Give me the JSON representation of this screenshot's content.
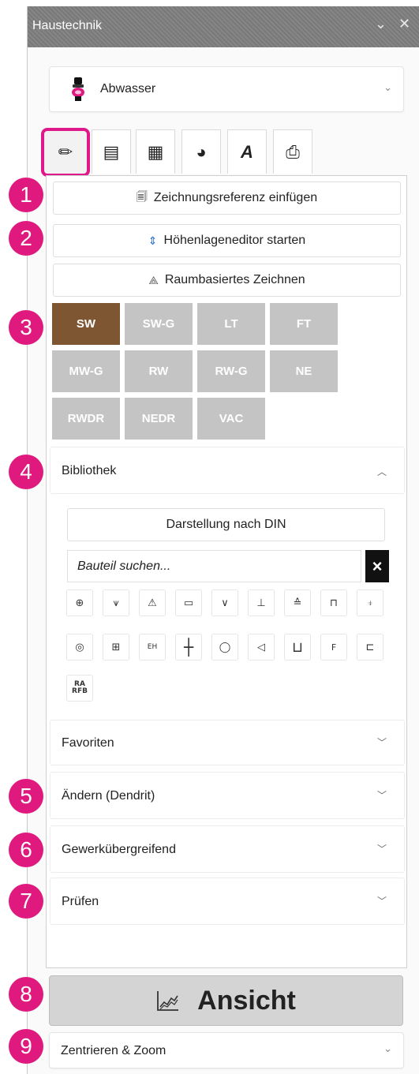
{
  "window": {
    "title": "Haustechnik",
    "chevron_icon": "⌄",
    "close_icon": "✕"
  },
  "domain_select": {
    "value": "Abwasser",
    "icon": "toilet-icon"
  },
  "tabs": [
    {
      "name": "draw",
      "glyph": "✏"
    },
    {
      "name": "list",
      "glyph": "▤"
    },
    {
      "name": "calculator",
      "glyph": "▦"
    },
    {
      "name": "chart",
      "glyph": "◕"
    },
    {
      "name": "text",
      "glyph": "A"
    },
    {
      "name": "print",
      "glyph": "⎙"
    }
  ],
  "actions": {
    "insert_reference": "Zeichnungsreferenz einfügen",
    "height_editor": "Höhenlageneditor starten",
    "room_drawing": "Raumbasiertes Zeichnen"
  },
  "categories": [
    "SW",
    "SW-G",
    "LT",
    "FT",
    "MW-G",
    "RW",
    "RW-G",
    "NE",
    "RWDR",
    "NEDR",
    "VAC"
  ],
  "active_category": "SW",
  "library": {
    "title": "Bibliothek",
    "din_button": "Darstellung nach DIN",
    "search_placeholder": "Bauteil suchen...",
    "clear_label": "×",
    "symbols_row1": [
      "⊕",
      "⩛",
      "⚠",
      "▭",
      "∨",
      "⊥",
      "≙",
      "⊓",
      "⍖"
    ],
    "symbols_row2": [
      "◎",
      "⊞",
      "EH",
      "┼",
      "◯",
      "◁",
      "⊔",
      "F",
      "⊏"
    ],
    "symbols_row3_label": "RA RFB"
  },
  "sections": [
    {
      "label": "Favoriten"
    },
    {
      "label": "Ändern (Dendrit)"
    },
    {
      "label": "Gewerkübergreifend"
    },
    {
      "label": "Prüfen"
    }
  ],
  "ansicht": {
    "label": "Ansicht"
  },
  "zoom_select": {
    "value": "Zentrieren & Zoom"
  },
  "badges": [
    "1",
    "2",
    "3",
    "4",
    "5",
    "6",
    "7",
    "8",
    "9"
  ],
  "colors": {
    "accent": "#e0197f",
    "active_category": "#7e5632",
    "inactive_category": "#c4c4c4",
    "titlebar": "#7f7f7f"
  }
}
